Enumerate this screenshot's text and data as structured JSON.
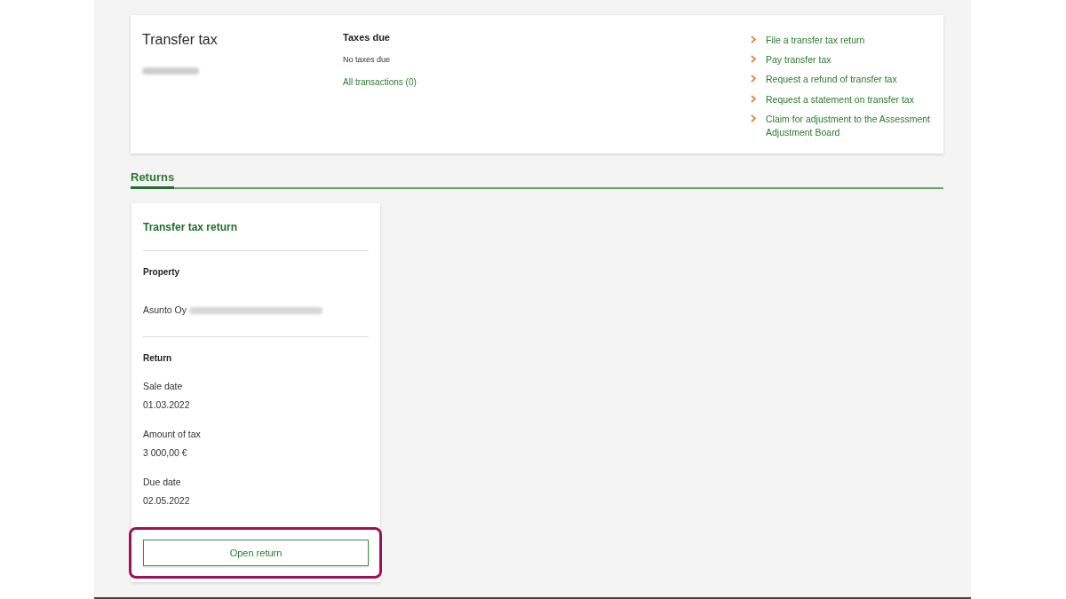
{
  "top_card": {
    "title": "Transfer tax",
    "subtitle_redacted": true,
    "taxes_due": {
      "heading": "Taxes due",
      "status": "No taxes due",
      "transactions_link": "All transactions (0)"
    },
    "links": [
      "File a transfer tax return",
      "Pay transfer tax",
      "Request a refund of transfer tax",
      "Request a statement on transfer tax",
      "Claim for adjustment to the Assessment Adjustment Board"
    ]
  },
  "tabs": [
    {
      "label": "Returns",
      "selected": true
    }
  ],
  "return_card": {
    "title": "Transfer tax return",
    "property": {
      "heading": "Property",
      "value": "Asunto Oy",
      "value_redacted": true
    },
    "return_section": {
      "heading": "Return",
      "fields": [
        {
          "label": "Sale date",
          "value": "01.03.2022"
        },
        {
          "label": "Amount of tax",
          "value": "3 000,00 €"
        },
        {
          "label": "Due date",
          "value": "02.05.2022"
        }
      ]
    },
    "button": {
      "label": "Open return",
      "highlighted": true
    }
  }
}
